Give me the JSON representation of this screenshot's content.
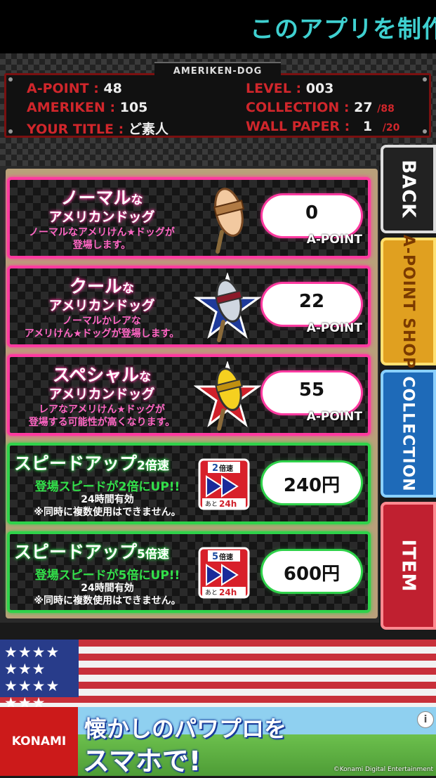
{
  "banner": {
    "text": "このアプリを制作"
  },
  "status": {
    "logo": "AMERIKEN-DOG",
    "apoint_label": "A-POINT :",
    "apoint_value": "48",
    "ameriken_label": "AMERIKEN :",
    "ameriken_value": "105",
    "title_label": "YOUR TITLE :",
    "title_value": "ど素人",
    "level_label": "LEVEL :",
    "level_value": "003",
    "collection_label": "COLLECTION :",
    "collection_value": "27",
    "collection_total": "/88",
    "wallpaper_label": "WALL PAPER :",
    "wallpaper_value": "1",
    "wallpaper_total": "/20"
  },
  "cards": [
    {
      "title": "ノーマル",
      "title_suffix": "な",
      "subtitle": "アメリカンドッグ",
      "desc1": "ノーマルなアメリけん★ドッグが",
      "desc2": "登場します。",
      "price": "0",
      "unit": "A-POINT"
    },
    {
      "title": "クール",
      "title_suffix": "な",
      "subtitle": "アメリカンドッグ",
      "desc1": "ノーマルかレアな",
      "desc2": "アメリけん★ドッグが登場します。",
      "price": "22",
      "unit": "A-POINT"
    },
    {
      "title": "スペシャル",
      "title_suffix": "な",
      "subtitle": "アメリカンドッグ",
      "desc1": "レアなアメリけん★ドッグが",
      "desc2": "登場する可能性が高くなります。",
      "price": "55",
      "unit": "A-POINT"
    },
    {
      "title": "スピードアップ",
      "title_suffix": "2倍速",
      "desc1": "登場スピードが2倍にUP!!",
      "desc2": "24時間有効",
      "desc3": "※同時に複数使用はできません。",
      "price": "240円",
      "badge_top": "2",
      "badge_top_suffix": "倍速",
      "badge_bottom": "24h",
      "badge_prefix": "あと"
    },
    {
      "title": "スピードアップ",
      "title_suffix": "5倍速",
      "desc1": "登場スピードが5倍にUP!!",
      "desc2": "24時間有効",
      "desc3": "※同時に複数使用はできません。",
      "price": "600円",
      "badge_top": "5",
      "badge_top_suffix": "倍速",
      "badge_bottom": "24h",
      "badge_prefix": "あと"
    }
  ],
  "tabs": {
    "back": "BACK",
    "shop": "A-POINT SHOP",
    "collection": "COLLECTION",
    "item": "ITEM"
  },
  "ad": {
    "brand": "KONAMI",
    "line1": "懐かしのパワプロを",
    "line2": "スマホで!",
    "copyright": "©Konami Digital Entertainment",
    "info": "i"
  },
  "flag": {
    "stars": "★★★★ ★★★ ★★★★ ★★★"
  },
  "colors": {
    "pink": "#ff3aa0",
    "green": "#2fd24a",
    "label_red": "#d0262b",
    "banner_cyan": "#3fd0d0"
  }
}
